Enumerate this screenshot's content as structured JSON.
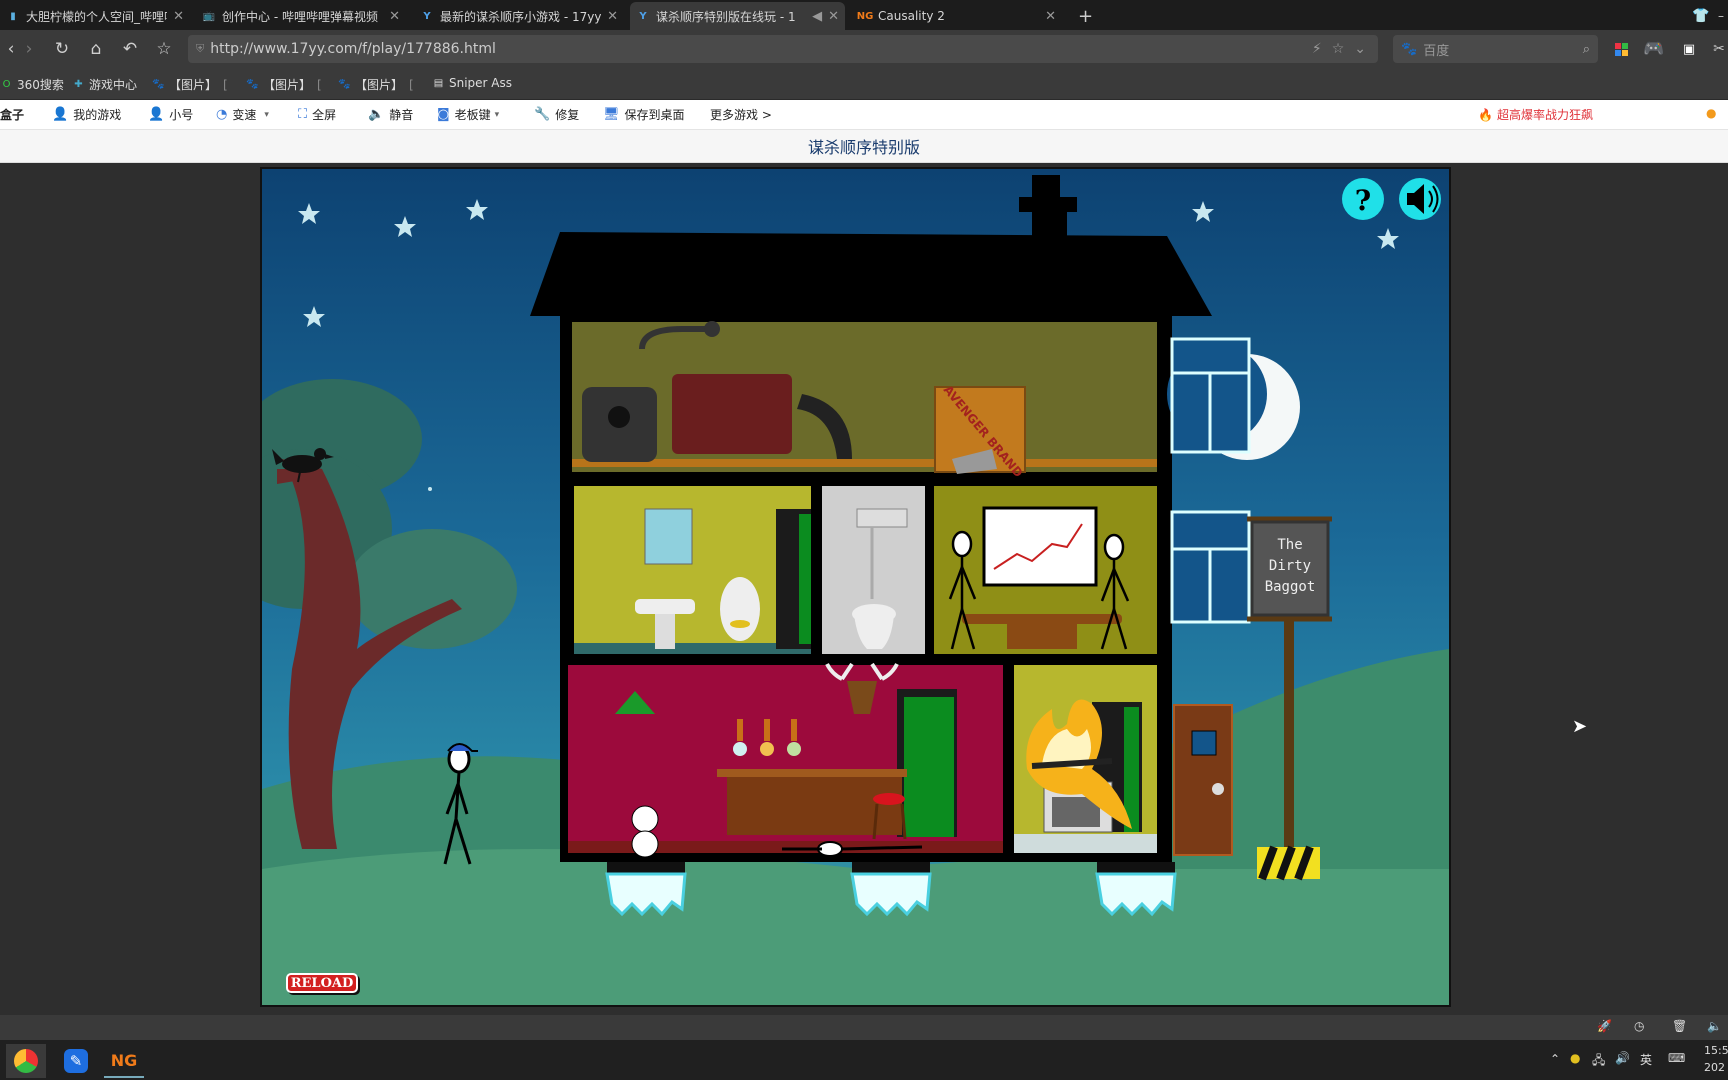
{
  "tabs": [
    {
      "title": "大胆柠檬的个人空间_哔哩哔哩",
      "icon": "bilibili-icon",
      "active": false
    },
    {
      "title": "创作中心 - 哔哩哔哩弹幕视频",
      "icon": "bilibili-tv-icon",
      "active": false
    },
    {
      "title": "最新的谋杀顺序小游戏 - 17yy",
      "icon": "17yy-icon",
      "active": false
    },
    {
      "title": "谋杀顺序特别版在线玩 - 1",
      "icon": "17yy-icon",
      "active": true
    },
    {
      "title": "Causality 2",
      "icon": "newgrounds-icon",
      "icon_text": "NG",
      "active": false
    }
  ],
  "nav": {
    "url": "http://www.17yy.com/f/play/177886.html",
    "search_placeholder": "百度"
  },
  "bookmarks": [
    "360搜索",
    "游戏中心",
    "【图片】",
    "【图片】",
    "【图片】",
    "Sniper Ass"
  ],
  "toolbar": {
    "box_label": "盒子",
    "items": [
      "我的游戏",
      "小号",
      "变速",
      "全屏",
      "静音",
      "老板键",
      "修复",
      "保存到桌面",
      "更多游戏 >"
    ],
    "promo": "超高爆率战力狂飙"
  },
  "game_title": "谋杀顺序特别版",
  "game": {
    "pub_sign": [
      "The",
      "Dirty",
      "Baggot"
    ],
    "reload_label": "RELOAD",
    "help_label": "?",
    "crate_label": "AVENGER BRAND"
  },
  "colors": {
    "sky": "#0d4272",
    "wall_red": "#9c0a3c",
    "wall_olive": "#8f8f16",
    "accent": "#3b7ad9"
  },
  "taskbar": {
    "tray_ime": "英",
    "clock": "15:5",
    "year": "202"
  }
}
